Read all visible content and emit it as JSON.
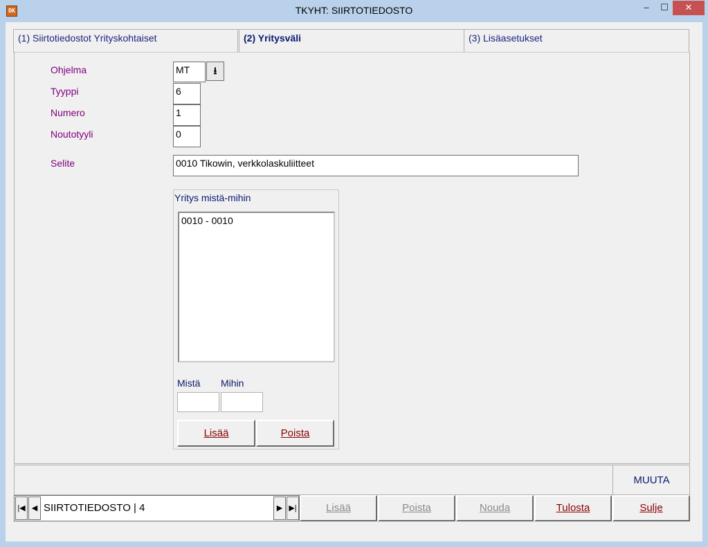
{
  "window": {
    "title": "TKYHT: SIIRTOTIEDOSTO",
    "app_icon_text": "DK",
    "min": "‒",
    "max": "☐",
    "close": "✕"
  },
  "tabs": [
    {
      "label": "(1) Siirtotiedostot Yrityskohtaiset"
    },
    {
      "label": "(2) Yritysväli"
    },
    {
      "label": "(3) Lisäasetukset"
    }
  ],
  "form": {
    "ohjelma_label": "Ohjelma",
    "ohjelma_value": "MT",
    "tyyppi_label": "Tyyppi",
    "tyyppi_value": "6",
    "numero_label": "Numero",
    "numero_value": "1",
    "noutotyyli_label": "Noutotyyli",
    "noutotyyli_value": "0",
    "selite_label": "Selite",
    "selite_value": "0010 Tikowin, verkkolaskuliitteet"
  },
  "company_range": {
    "title": "Yritys mistä-mihin",
    "items": [
      "0010 - 0010"
    ],
    "from_label": "Mistä",
    "to_label": "Mihin",
    "from_value": "",
    "to_value": "",
    "add_button": "Lisää",
    "remove_button": "Poista"
  },
  "status": {
    "mode": "MUUTA"
  },
  "navigator": {
    "text": "SIIRTOTIEDOSTO    |  4",
    "first": "|◀",
    "prev": "◀",
    "next": "▶",
    "last": "▶|"
  },
  "toolbar": {
    "add": "Lisää",
    "remove": "Poista",
    "fetch": "Nouda",
    "print": "Tulosta",
    "close": "Sulje"
  }
}
